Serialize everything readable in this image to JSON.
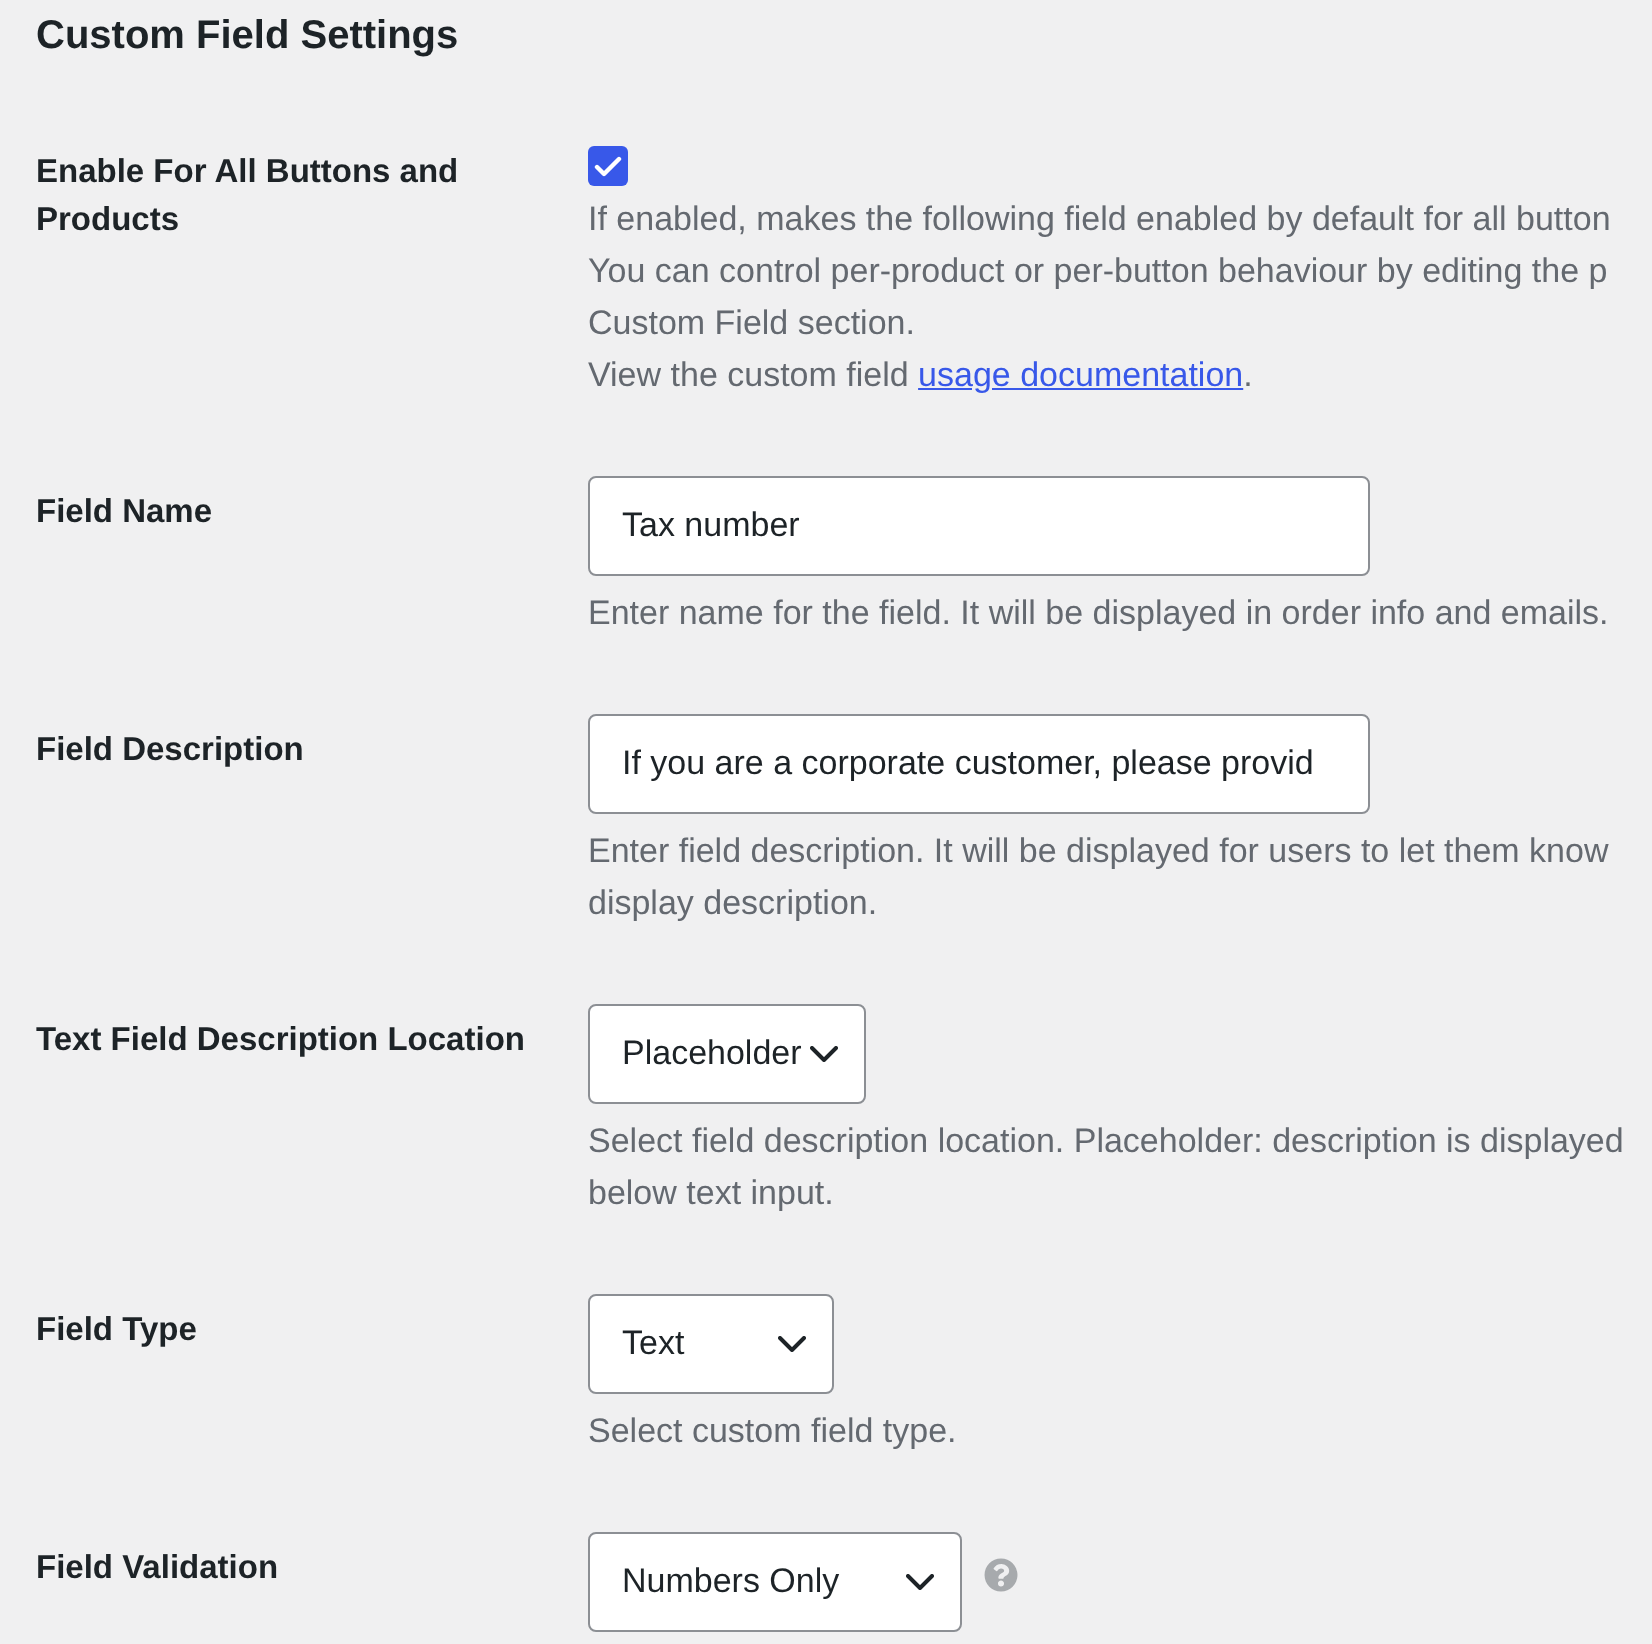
{
  "title": "Custom Field Settings",
  "rows": [
    {
      "kind": "checkbox",
      "label": "Enable For All Buttons and Products",
      "checked": true,
      "description": [
        "If enabled, makes the following field enabled by default for all button",
        "You can control per-product or per-button behaviour by editing the p",
        "Custom Field section."
      ],
      "link_line": {
        "before": "View the custom field ",
        "link": "usage documentation",
        "after": "."
      }
    },
    {
      "kind": "text",
      "label": "Field Name",
      "value": "Tax number",
      "description": [
        "Enter name for the field. It will be displayed in order info and emails."
      ]
    },
    {
      "kind": "text",
      "label": "Field Description",
      "value": "If you are a corporate customer, please provid",
      "description": [
        "Enter field description. It will be displayed for users to let them know",
        "display description."
      ]
    },
    {
      "kind": "select",
      "label": "Text Field Description Location",
      "value": "Placeholder",
      "description": [
        "Select field description location. Placeholder: description is displayed",
        "below text input."
      ]
    },
    {
      "kind": "select",
      "label": "Field Type",
      "value": "Text",
      "description": [
        "Select custom field type."
      ]
    },
    {
      "kind": "select",
      "label": "Field Validation",
      "value": "Numbers Only",
      "help": true
    }
  ]
}
